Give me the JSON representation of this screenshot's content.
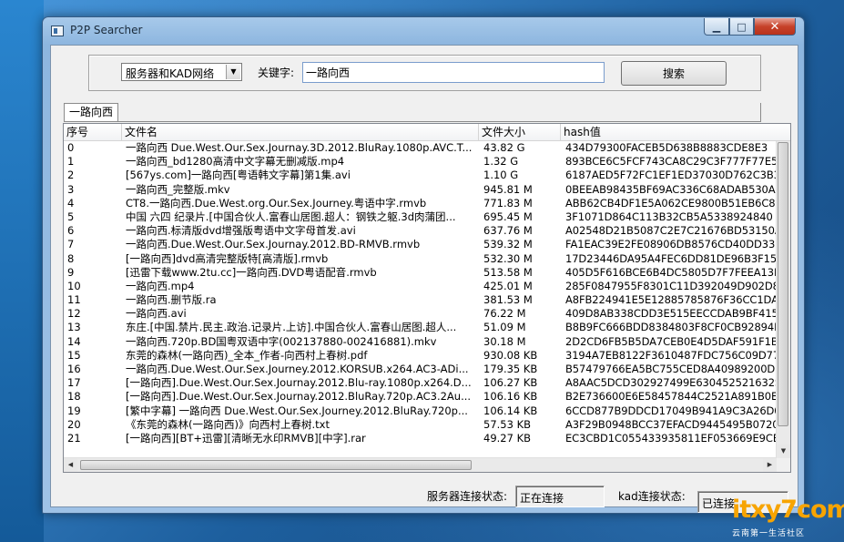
{
  "window": {
    "title": "P2P Searcher"
  },
  "search": {
    "network_selected": "服务器和KAD网络",
    "keyword_label": "关键字:",
    "keyword_value": "一路向西",
    "search_button": "搜索"
  },
  "tabs": [
    {
      "label": "一路向西"
    }
  ],
  "table": {
    "columns": [
      "序号",
      "文件名",
      "文件大小",
      "hash值"
    ],
    "rows": [
      [
        "0",
        "一路向西 Due.West.Our.Sex.Journay.3D.2012.BluRay.1080p.AVC.T...",
        "43.82 G",
        "434D79300FACEB5D638B8883CDE8E3"
      ],
      [
        "1",
        "一路向西_bd1280高清中文字幕无删减版.mp4",
        "1.32 G",
        "893BCE6C5FCF743CA8C29C3F777F77E5"
      ],
      [
        "2",
        "[567ys.com]一路向西[粤语韩文字幕]第1集.avi",
        "1.10 G",
        "6187AED5F72FC1EF1ED37030D762C3B3"
      ],
      [
        "3",
        "一路向西_完整版.mkv",
        "945.81 M",
        "0BEEAB98435BF69AC336C68ADAB530A"
      ],
      [
        "4",
        "CT8.一路向西.Due.West.org.Our.Sex.Journey.粤语中字.rmvb",
        "771.83 M",
        "ABB62CB4DF1E5A062CE9800B51EB6C8D"
      ],
      [
        "5",
        "中国 六四 纪录片.[中国合伙人.富春山居图.超人：钢铁之躯.3d肉蒲团...",
        "695.45 M",
        "3F1071D864C113B32CB5A5338924840"
      ],
      [
        "6",
        "一路向西.标清版dvd增强版粤语中文字母首发.avi",
        "637.76 M",
        "A02548D21B5087C2E7C21676BD53150A"
      ],
      [
        "7",
        "一路向西.Due.West.Our.Sex.Journay.2012.BD-RMVB.rmvb",
        "539.32 M",
        "FA1EAC39E2FE08906DB8576CD40DD33"
      ],
      [
        "8",
        "[一路向西]dvd高清完整版特[高清版].rmvb",
        "532.30 M",
        "17D23446DA95A4FEC6DD81DE96B3F15"
      ],
      [
        "9",
        "[迅雷下载www.2tu.cc]一路向西.DVD粤语配音.rmvb",
        "513.58 M",
        "405D5F616BCE6B4DC5805D7F7FEEA13B"
      ],
      [
        "10",
        "一路向西.mp4",
        "425.01 M",
        "285F0847955F8301C11D392049D902D8"
      ],
      [
        "11",
        "一路向西.删节版.ra",
        "381.53 M",
        "A8FB224941E5E12885785876F36CC1DA"
      ],
      [
        "12",
        "一路向西.avi",
        "76.22 M",
        "409D8AB338CDD3E515EECCDAB9BF415"
      ],
      [
        "13",
        "东庄.[中国.禁片.民主.政治.记录片.上访].中国合伙人.富春山居图.超人...",
        "51.09 M",
        "B8B9FC666BDD8384803F8CF0CB92894E"
      ],
      [
        "14",
        "一路向西.720p.BD国粤双语中字(002137880-002416881).mkv",
        "30.18 M",
        "2D2CD6FB5B5DA7CEB0E4D5DAF591F1B0"
      ],
      [
        "15",
        "东莞的森林(一路向西)_全本_作者-向西村上春树.pdf",
        "930.08 KB",
        "3194A7EB8122F3610487FDC756C09D77"
      ],
      [
        "16",
        "一路向西.Due.West.Our.Sex.Journey.2012.KORSUB.x264.AC3-ADi...",
        "179.35 KB",
        "B57479766EA5BC755CED8A40989200D3"
      ],
      [
        "17",
        "[一路向西].Due.West.Our.Sex.Journay.2012.Blu-ray.1080p.x264.D...",
        "106.27 KB",
        "A8AAC5DCD302927499E630452521632S"
      ],
      [
        "18",
        "[一路向西].Due.West.Our.Sex.Journay.2012.BluRay.720p.AC3.2Au...",
        "106.16 KB",
        "B2E736600E6E58457844C2521A891B0E"
      ],
      [
        "19",
        "[繁中字幕] 一路向西 Due.West.Our.Sex.Journey.2012.BluRay.720p...",
        "106.14 KB",
        "6CCD877B9DDCD17049B941A9C3A26D0"
      ],
      [
        "20",
        "《东莞的森林(一路向西)》向西村上春树.txt",
        "57.53 KB",
        "A3F29B0948BCC37EFACD9445495B0720"
      ],
      [
        "21",
        "[一路向西][BT+迅雷][清晰无水印RMVB][中字].rar",
        "49.27 KB",
        "EC3CBD1C055433935811EF053669E9CB"
      ]
    ]
  },
  "status": {
    "server_label": "服务器连接状态:",
    "server_value": "正在连接",
    "kad_label": "kad连接状态:",
    "kad_value": "已连接"
  },
  "watermark": {
    "logo": "itxy7com",
    "tagline": "云南第一生活社区"
  }
}
